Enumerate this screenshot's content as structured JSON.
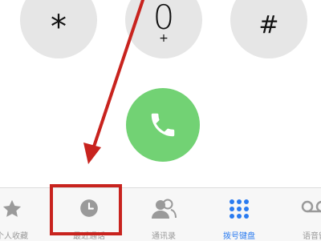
{
  "keypad": {
    "keys": [
      {
        "label": "*",
        "sub": ""
      },
      {
        "label": "0",
        "sub": "+"
      },
      {
        "label": "#",
        "sub": ""
      }
    ]
  },
  "call_button": {
    "icon": "phone-icon",
    "color": "#72d274"
  },
  "tab_bar": {
    "active": "keypad",
    "tabs": [
      {
        "id": "favorites",
        "label": "个人收藏",
        "icon": "star-icon"
      },
      {
        "id": "recents",
        "label": "最近通话",
        "icon": "clock-icon"
      },
      {
        "id": "contacts",
        "label": "通讯录",
        "icon": "contacts-icon"
      },
      {
        "id": "keypad",
        "label": "拨号键盘",
        "icon": "keypad-grid-icon"
      },
      {
        "id": "voicemail",
        "label": "语音留",
        "icon": "voicemail-icon"
      }
    ]
  },
  "annotation": {
    "color": "#c8231e",
    "target": "recents"
  },
  "colors": {
    "accent": "#2a7bf0",
    "inactive": "#9a9a9a",
    "key_bg": "#e6e6e6"
  }
}
